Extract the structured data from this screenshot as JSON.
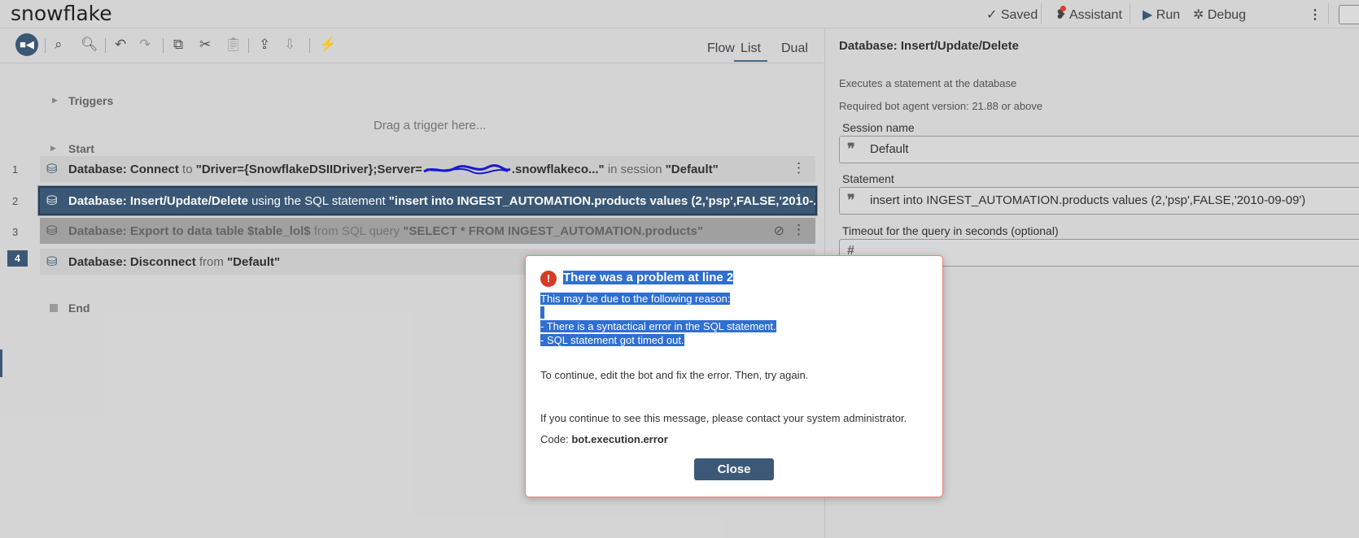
{
  "app": {
    "title": "snowflake"
  },
  "topbar": {
    "saved": "Saved",
    "assistant": "Assistant",
    "run": "Run",
    "debug": "Debug"
  },
  "views": [
    "Flow",
    "List",
    "Dual"
  ],
  "editor": {
    "triggers_label": "Triggers",
    "drag_hint": "Drag a trigger here...",
    "start_label": "Start",
    "end_label": "End",
    "lines": [
      {
        "no": "1",
        "action": "Database: Connect",
        "mid": "to",
        "value_pre": "\"Driver={SnowflakeDSIIDriver};Server=",
        "value_post": ".snowflakeco...\"",
        "tail": "in session",
        "tail_value": "\"Default\""
      },
      {
        "no": "2",
        "action": "Database: Insert/Update/Delete",
        "mid": "using the SQL statement",
        "value": "\"insert into INGEST_AUTOMATION.products values (2,'psp',FALSE,'2010-..."
      },
      {
        "no": "3",
        "action": "Database: Export to data table $table_lol$",
        "mid": "from SQL query",
        "value": "\"SELECT * FROM INGEST_AUTOMATION.products\""
      },
      {
        "no": "4",
        "action": "Database: Disconnect",
        "mid": "from",
        "value": "\"Default\""
      }
    ]
  },
  "properties": {
    "title": "Database: Insert/Update/Delete",
    "description": "Executes a statement at the database",
    "version": "Required bot agent version: 21.88 or above",
    "session_label": "Session name",
    "session_value": "Default",
    "statement_label": "Statement",
    "statement_value": "insert into INGEST_AUTOMATION.products values (2,'psp',FALSE,'2010-09-09')",
    "timeout_label": "Timeout for the query in seconds (optional)"
  },
  "dialog": {
    "title": "There was a problem at line 2",
    "reason_intro": "This may be due to the following reason:",
    "reason_1": "- There is a syntactical error in the SQL statement.",
    "reason_2": "- SQL statement got timed out.",
    "continue_text": "To continue, edit the bot and fix the error. Then, try again.",
    "contact_text": "If you continue to see this message, please contact your system administrator.",
    "code_label": "Code:",
    "code_value": "bot.execution.error",
    "close_label": "Close"
  },
  "colors": {
    "accent": "#3c5a78",
    "error": "#d63b26",
    "selection": "#2f6fd1"
  }
}
